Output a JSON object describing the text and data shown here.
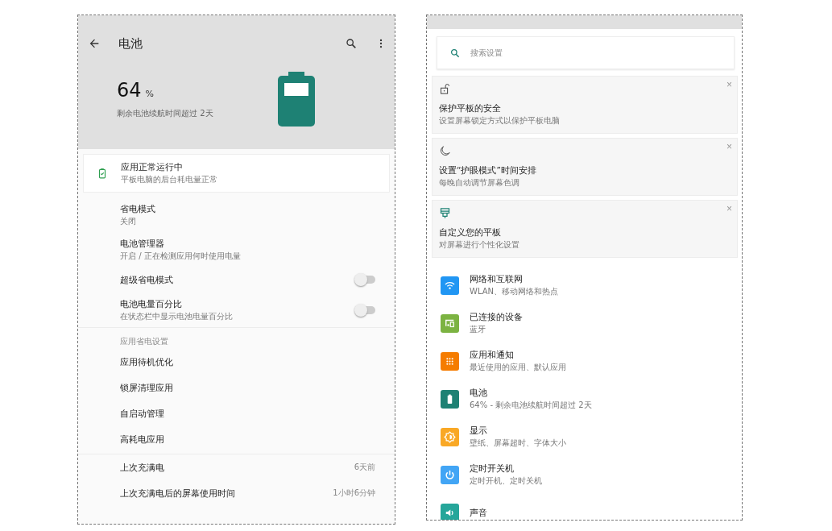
{
  "battery_screen": {
    "title": "电池",
    "percent": "64",
    "percent_unit": "%",
    "estimate": "剩余电池续航时间超过 2天",
    "status_card": {
      "title": "应用正常运行中",
      "subtitle": "平板电脑的后台耗电量正常"
    },
    "settings": [
      {
        "kind": "item",
        "title": "省电模式",
        "subtitle": "关闭"
      },
      {
        "kind": "item",
        "title": "电池管理器",
        "subtitle": "开启 / 正在检测应用何时使用电量"
      },
      {
        "kind": "toggle",
        "title": "超级省电模式",
        "on": false
      },
      {
        "kind": "toggle",
        "title": "电池电量百分比",
        "subtitle": "在状态栏中显示电池电量百分比",
        "on": false
      }
    ],
    "section_header": "应用省电设置",
    "app_items": [
      "应用待机优化",
      "锁屏清理应用",
      "自启动管理",
      "高耗电应用"
    ],
    "usage": [
      {
        "label": "上次充满电",
        "value": "6天前"
      },
      {
        "label": "上次充满电后的屏幕使用时间",
        "value": "1小时6分钟"
      }
    ]
  },
  "settings_screen": {
    "search": {
      "placeholder": "搜索设置"
    },
    "suggestions": [
      {
        "kind": "lock",
        "title": "保护平板的安全",
        "subtitle": "设置屏幕锁定方式以保护平板电脑",
        "dismiss": "×"
      },
      {
        "kind": "moon",
        "title": "设置“护眼模式”时间安排",
        "subtitle": "每晚自动调节屏幕色调",
        "dismiss": "×"
      },
      {
        "kind": "brush",
        "title": "自定义您的平板",
        "subtitle": "对屏幕进行个性化设置",
        "dismiss": "×"
      }
    ],
    "categories": [
      {
        "kind": "wifi",
        "color": "#2196f3",
        "title": "网络和互联网",
        "subtitle": "WLAN、移动网络和热点"
      },
      {
        "kind": "devices",
        "color": "#7cb342",
        "title": "已连接的设备",
        "subtitle": "蓝牙"
      },
      {
        "kind": "apps",
        "color": "#f57c00",
        "title": "应用和通知",
        "subtitle": "最近使用的应用、默认应用"
      },
      {
        "kind": "battery",
        "color": "#1e8174",
        "title": "电池",
        "subtitle": "64% - 剩余电池续航时间超过 2天"
      },
      {
        "kind": "display",
        "color": "#f9a825",
        "title": "显示",
        "subtitle": "壁纸、屏幕超时、字体大小"
      },
      {
        "kind": "power",
        "color": "#42a5f5",
        "title": "定时开关机",
        "subtitle": "定时开机、定时关机"
      },
      {
        "kind": "sound",
        "color": "#26a69a",
        "title": "声音"
      }
    ]
  }
}
